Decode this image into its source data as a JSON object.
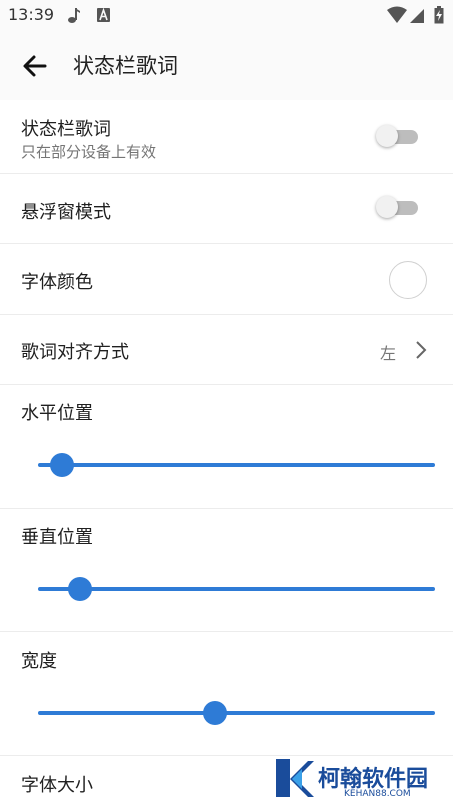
{
  "status_bar": {
    "time": "13:39",
    "icons": [
      "music-note-icon",
      "font-a-icon",
      "wifi-icon",
      "signal-icon",
      "battery-charging-icon"
    ]
  },
  "app_bar": {
    "back_icon": "arrow-left-icon",
    "title": "状态栏歌词"
  },
  "settings": {
    "status_lyrics": {
      "label": "状态栏歌词",
      "sublabel": "只在部分设备上有效",
      "enabled": false
    },
    "floating_mode": {
      "label": "悬浮窗模式",
      "enabled": false
    },
    "font_color": {
      "label": "字体颜色",
      "color": "#ffffff"
    },
    "alignment": {
      "label": "歌词对齐方式",
      "value": "左"
    },
    "horizontal_position": {
      "label": "水平位置",
      "value": 0.06
    },
    "vertical_position": {
      "label": "垂直位置",
      "value": 0.105
    },
    "width": {
      "label": "宽度",
      "value": 0.445
    },
    "font_size": {
      "label": "字体大小"
    }
  },
  "watermark": {
    "name": "柯翰软件园",
    "url": "KEHAN88.COM"
  },
  "colors": {
    "accent": "#2e7bd6",
    "switch_off_track": "#bdbdbd",
    "switch_off_thumb": "#f1f1f1",
    "watermark": "#1a4c9b"
  }
}
